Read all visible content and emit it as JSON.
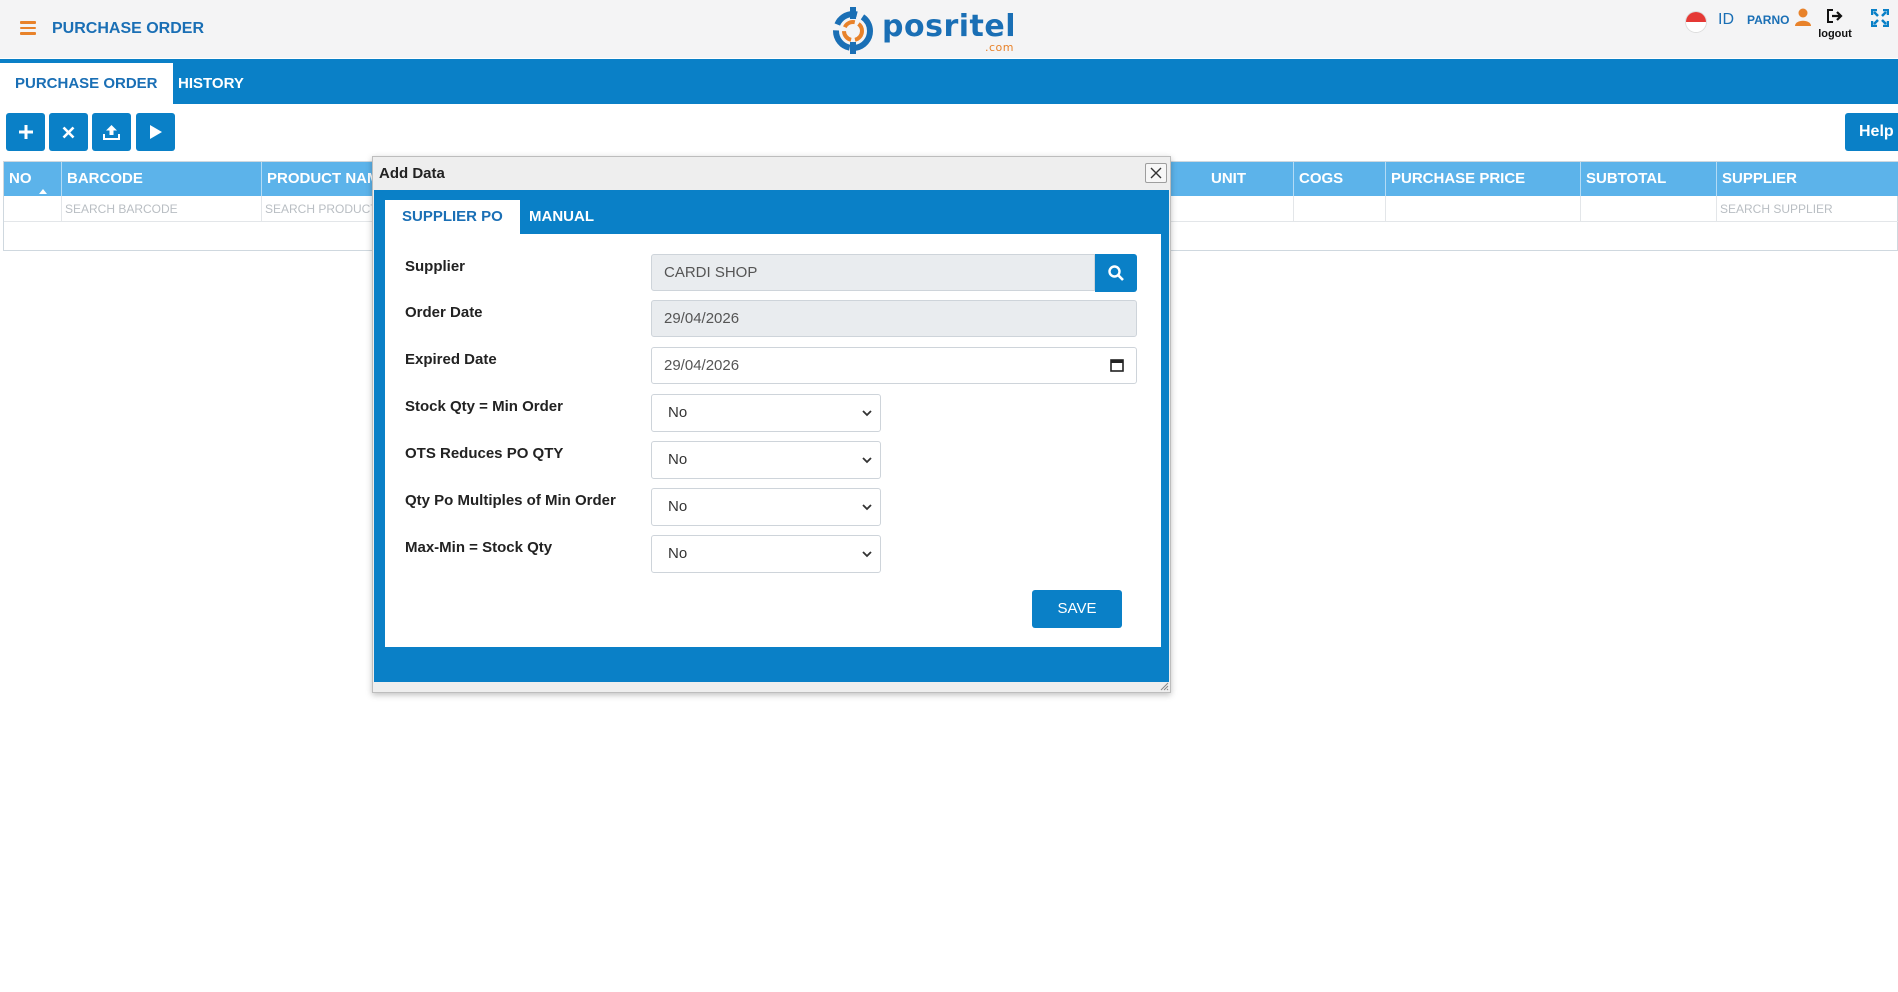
{
  "header": {
    "menu_icon": "hamburger-icon",
    "title": "PURCHASE ORDER",
    "logo_text": "posritel",
    "logo_suffix": ".com",
    "language": "ID",
    "username": "PARNO",
    "logout_label": "logout",
    "colors": {
      "brand_blue": "#0a80c7",
      "brand_orange": "#e8822a"
    }
  },
  "nav": {
    "tabs": [
      {
        "label": "PURCHASE ORDER",
        "active": true
      },
      {
        "label": "HISTORY",
        "active": false
      }
    ]
  },
  "toolbar": {
    "buttons": [
      "plus-icon",
      "close-icon",
      "upload-icon",
      "play-icon"
    ],
    "help_label": "Help"
  },
  "grid": {
    "columns": [
      "NO",
      "BARCODE",
      "PRODUCT NAME",
      "UNIT",
      "COGS",
      "PURCHASE PRICE",
      "SUBTOTAL",
      "SUPPLIER"
    ],
    "filters": {
      "barcode_placeholder": "SEARCH BARCODE",
      "product_placeholder": "SEARCH PRODUCT",
      "supplier_placeholder": "SEARCH SUPPLIER"
    }
  },
  "modal": {
    "title": "Add Data",
    "tabs": [
      {
        "label": "SUPPLIER PO",
        "active": true
      },
      {
        "label": "MANUAL",
        "active": false
      }
    ],
    "fields": {
      "supplier": {
        "label": "Supplier",
        "value": "CARDI  SHOP"
      },
      "order_date": {
        "label": "Order Date",
        "value": "29/04/2026"
      },
      "expired_date": {
        "label": "Expired Date",
        "value": "29/04/2026"
      },
      "stock_qty_min_order": {
        "label": "Stock Qty = Min Order",
        "value": "No"
      },
      "ots_reduces_po_qty": {
        "label": "OTS Reduces PO QTY",
        "value": "No"
      },
      "qty_po_multiples": {
        "label": "Qty Po Multiples of Min Order",
        "value": "No"
      },
      "max_min_stock_qty": {
        "label": "Max-Min = Stock Qty",
        "value": "No"
      }
    },
    "save_label": "SAVE"
  }
}
